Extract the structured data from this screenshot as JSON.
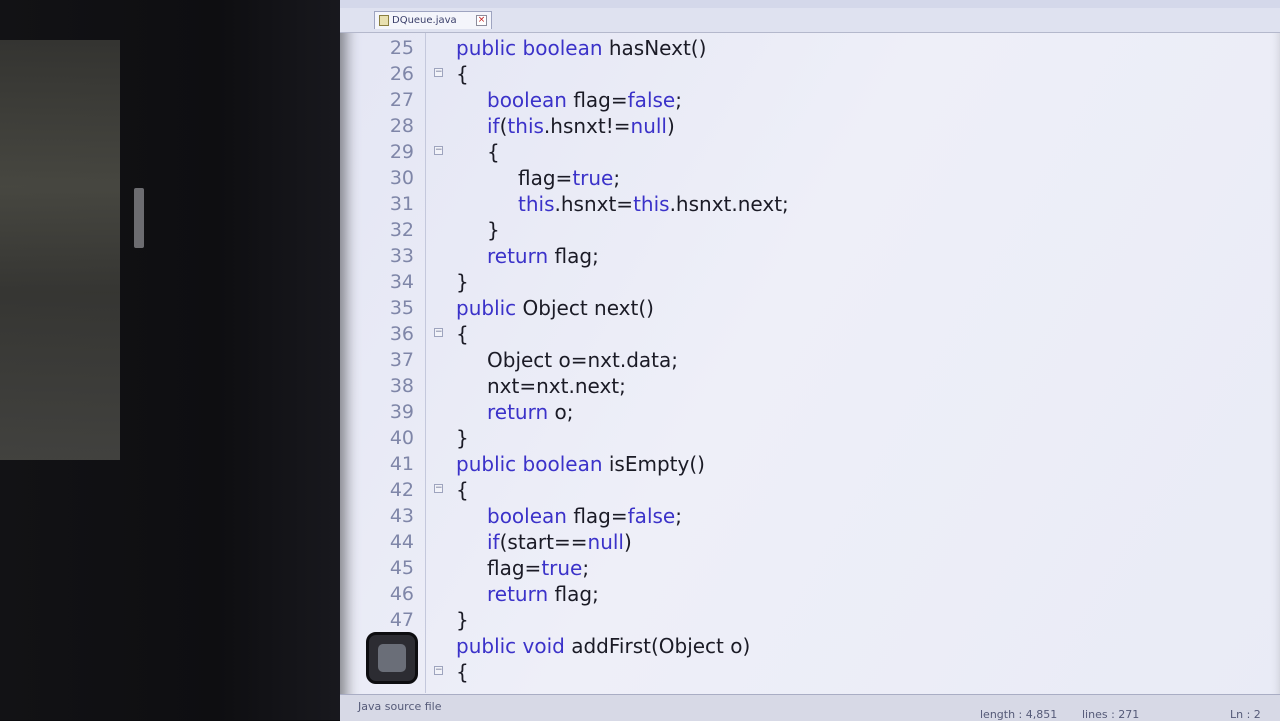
{
  "tab": {
    "filename": "DQueue.java"
  },
  "status": {
    "file_type": "Java source file",
    "length": "length : 4,851",
    "lines": "lines : 271",
    "position": "Ln : 2"
  },
  "code": {
    "lines": [
      {
        "num": "25",
        "fold": "",
        "indent": 0,
        "tokens": [
          {
            "t": "public boolean",
            "k": true
          },
          {
            "t": " hasNext()",
            "k": false
          }
        ]
      },
      {
        "num": "26",
        "fold": "⊟",
        "indent": 0,
        "tokens": [
          {
            "t": "{",
            "k": false
          }
        ]
      },
      {
        "num": "27",
        "fold": "",
        "indent": 1,
        "tokens": [
          {
            "t": "boolean",
            "k": true
          },
          {
            "t": " flag=",
            "k": false
          },
          {
            "t": "false",
            "k": true
          },
          {
            "t": ";",
            "k": false
          }
        ]
      },
      {
        "num": "28",
        "fold": "",
        "indent": 1,
        "tokens": [
          {
            "t": "if",
            "k": true
          },
          {
            "t": "(",
            "k": false
          },
          {
            "t": "this",
            "k": true
          },
          {
            "t": ".hsnxt!=",
            "k": false
          },
          {
            "t": "null",
            "k": true
          },
          {
            "t": ")",
            "k": false
          }
        ]
      },
      {
        "num": "29",
        "fold": "⊟",
        "indent": 1,
        "tokens": [
          {
            "t": "{",
            "k": false
          }
        ]
      },
      {
        "num": "30",
        "fold": "",
        "indent": 2,
        "tokens": [
          {
            "t": "flag=",
            "k": false
          },
          {
            "t": "true",
            "k": true
          },
          {
            "t": ";",
            "k": false
          }
        ]
      },
      {
        "num": "31",
        "fold": "",
        "indent": 2,
        "tokens": [
          {
            "t": "this",
            "k": true
          },
          {
            "t": ".hsnxt=",
            "k": false
          },
          {
            "t": "this",
            "k": true
          },
          {
            "t": ".hsnxt.next;",
            "k": false
          }
        ]
      },
      {
        "num": "32",
        "fold": "",
        "indent": 1,
        "tokens": [
          {
            "t": "}",
            "k": false
          }
        ]
      },
      {
        "num": "33",
        "fold": "",
        "indent": 1,
        "tokens": [
          {
            "t": "return",
            "k": true
          },
          {
            "t": " flag;",
            "k": false
          }
        ]
      },
      {
        "num": "34",
        "fold": "",
        "indent": 0,
        "tokens": [
          {
            "t": "}",
            "k": false
          }
        ]
      },
      {
        "num": "35",
        "fold": "",
        "indent": 0,
        "tokens": [
          {
            "t": "public",
            "k": true
          },
          {
            "t": " Object next()",
            "k": false
          }
        ]
      },
      {
        "num": "36",
        "fold": "⊟",
        "indent": 0,
        "tokens": [
          {
            "t": "{",
            "k": false
          }
        ]
      },
      {
        "num": "37",
        "fold": "",
        "indent": 1,
        "tokens": [
          {
            "t": "Object o=nxt.data;",
            "k": false
          }
        ]
      },
      {
        "num": "38",
        "fold": "",
        "indent": 1,
        "tokens": [
          {
            "t": "nxt=nxt.next;",
            "k": false
          }
        ]
      },
      {
        "num": "39",
        "fold": "",
        "indent": 1,
        "tokens": [
          {
            "t": "return",
            "k": true
          },
          {
            "t": " o;",
            "k": false
          }
        ]
      },
      {
        "num": "40",
        "fold": "",
        "indent": 0,
        "tokens": [
          {
            "t": "}",
            "k": false
          }
        ]
      },
      {
        "num": "41",
        "fold": "",
        "indent": 0,
        "tokens": [
          {
            "t": "public boolean",
            "k": true
          },
          {
            "t": " isEmpty()",
            "k": false
          }
        ]
      },
      {
        "num": "42",
        "fold": "⊟",
        "indent": 0,
        "tokens": [
          {
            "t": "{",
            "k": false
          }
        ]
      },
      {
        "num": "43",
        "fold": "",
        "indent": 1,
        "tokens": [
          {
            "t": "boolean",
            "k": true
          },
          {
            "t": " flag=",
            "k": false
          },
          {
            "t": "false",
            "k": true
          },
          {
            "t": ";",
            "k": false
          }
        ]
      },
      {
        "num": "44",
        "fold": "",
        "indent": 1,
        "tokens": [
          {
            "t": "if",
            "k": true
          },
          {
            "t": "(start==",
            "k": false
          },
          {
            "t": "null",
            "k": true
          },
          {
            "t": ")",
            "k": false
          }
        ]
      },
      {
        "num": "45",
        "fold": "",
        "indent": 1,
        "tokens": [
          {
            "t": "flag=",
            "k": false
          },
          {
            "t": "true",
            "k": true
          },
          {
            "t": ";",
            "k": false
          }
        ]
      },
      {
        "num": "46",
        "fold": "",
        "indent": 1,
        "tokens": [
          {
            "t": "return",
            "k": true
          },
          {
            "t": " flag;",
            "k": false
          }
        ]
      },
      {
        "num": "47",
        "fold": "",
        "indent": 0,
        "tokens": [
          {
            "t": "}",
            "k": false
          }
        ]
      },
      {
        "num": "",
        "fold": "",
        "indent": 0,
        "tokens": [
          {
            "t": "public void",
            "k": true
          },
          {
            "t": " addFirst(Object o)",
            "k": false
          }
        ]
      },
      {
        "num": "",
        "fold": "⊟",
        "indent": 0,
        "tokens": [
          {
            "t": "{",
            "k": false
          }
        ]
      }
    ]
  }
}
